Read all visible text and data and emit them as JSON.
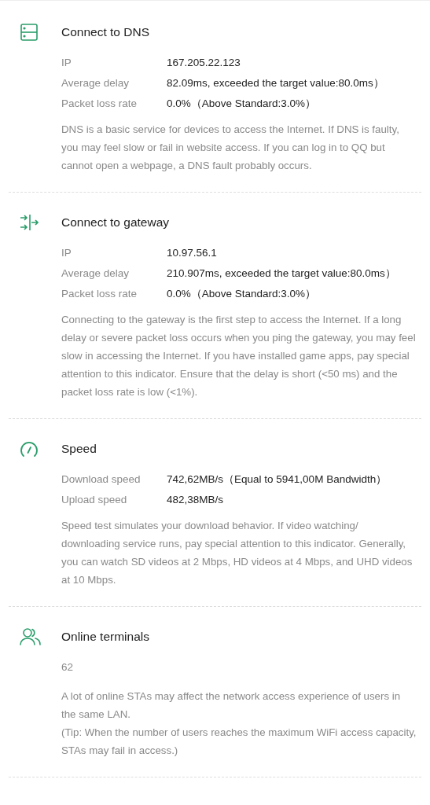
{
  "sections": [
    {
      "kind": "dns",
      "title": "Connect to DNS",
      "rows": [
        {
          "label": "IP",
          "value": "167.205.22.123"
        },
        {
          "label": "Average delay",
          "value": "82.09ms, exceeded the target value:80.0ms）"
        },
        {
          "label": "Packet loss rate",
          "value": "0.0%（Above Standard:3.0%）"
        }
      ],
      "notes": [
        "DNS is a basic service for devices to access the Internet. If DNS is faulty, you may feel slow or fail in website access. If you can log in to QQ but cannot open a webpage, a DNS fault probably occurs."
      ]
    },
    {
      "kind": "gateway",
      "title": "Connect to gateway",
      "rows": [
        {
          "label": "IP",
          "value": "10.97.56.1"
        },
        {
          "label": "Average delay",
          "value": "210.907ms, exceeded the target value:80.0ms）"
        },
        {
          "label": "Packet loss rate",
          "value": "0.0%（Above Standard:3.0%）"
        }
      ],
      "notes": [
        "Connecting to the gateway is the first step to access the Internet. If a long delay or severe packet loss occurs when you ping the gateway, you may feel slow in accessing the Internet. If you have installed game apps, pay special attention to this indicator. Ensure that the delay is short (<50 ms) and the packet loss rate is low (<1%)."
      ]
    },
    {
      "kind": "speed",
      "title": "Speed",
      "rows": [
        {
          "label": "Download speed",
          "value": "742,62MB/s（Equal to 5941,00M Bandwidth）"
        },
        {
          "label": "Upload speed",
          "value": "482,38MB/s"
        }
      ],
      "notes": [
        "Speed test simulates your download behavior. If video watching/ downloading service runs, pay special attention to this indicator. Generally, you can watch SD videos at 2 Mbps, HD videos at 4 Mbps, and UHD videos at 10 Mbps."
      ]
    },
    {
      "kind": "terminals",
      "title": "Online terminals",
      "count": "62",
      "notes": [
        "A lot of online STAs may affect the network access experience of users in the same LAN.",
        "(Tip: When the number of users reaches the maximum WiFi access capacity, STAs may fail in access.)"
      ]
    }
  ]
}
